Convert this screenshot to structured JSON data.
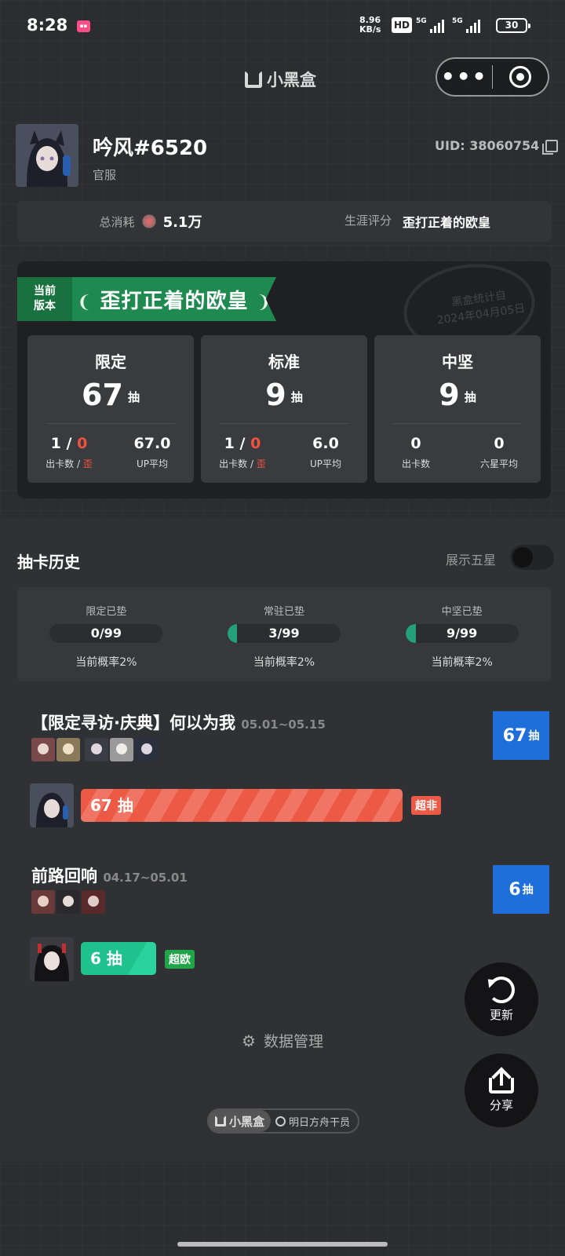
{
  "status": {
    "time": "8:28",
    "net_speed_value": "8.96",
    "net_speed_unit": "KB/s",
    "hd": "HD",
    "sig1": "5G",
    "sig2": "5G",
    "battery": "30"
  },
  "titlebar": {
    "brand": "小黑盒",
    "more": "•••"
  },
  "profile": {
    "name": "吟风#6520",
    "server": "官服",
    "uid": "UID: 38060754"
  },
  "summary": {
    "spend_label": "总消耗",
    "spend_value": "5.1万",
    "rating_label": "生涯评分",
    "rating_value": "歪打正着的欧皇"
  },
  "statcard": {
    "ribbon_tag_1": "当前",
    "ribbon_tag_2": "版本",
    "ribbon_title": "歪打正着的欧皇",
    "stamp_1": "黑盒统计自",
    "stamp_2": "2024年04月05日",
    "pools": [
      {
        "name": "限定",
        "count": "67",
        "unit": "抽",
        "stat1_a": "1",
        "stat1_b": "0",
        "stat1_label_a": "出卡数",
        "stat1_label_b": "歪",
        "stat2": "67.0",
        "stat2_label": "UP平均"
      },
      {
        "name": "标准",
        "count": "9",
        "unit": "抽",
        "stat1_a": "1",
        "stat1_b": "0",
        "stat1_label_a": "出卡数",
        "stat1_label_b": "歪",
        "stat2": "6.0",
        "stat2_label": "UP平均"
      },
      {
        "name": "中坚",
        "count": "9",
        "unit": "抽",
        "stat1": "0",
        "stat1_label": "出卡数",
        "stat2": "0",
        "stat2_label": "六星平均"
      }
    ]
  },
  "history": {
    "title": "抽卡历史",
    "show_five_star": "展示五星",
    "show_five_star_on": false,
    "pity": [
      {
        "label": "限定已垫",
        "value": "0/99",
        "progress": 0,
        "rate": "当前概率2%"
      },
      {
        "label": "常驻已垫",
        "value": "3/99",
        "progress": 0.03,
        "rate": "当前概率2%"
      },
      {
        "label": "中坚已垫",
        "value": "9/99",
        "progress": 0.09,
        "rate": "当前概率2%"
      }
    ],
    "banners": [
      {
        "title": "【限定寻访·庆典】何以为我",
        "date": "05.01~05.15",
        "count": "67",
        "unit": "抽",
        "bar_label": "67 抽",
        "tag": "超非",
        "tag_color": "#ec5a46"
      },
      {
        "title": "前路回响",
        "date": "04.17~05.01",
        "count": "6",
        "unit": "抽",
        "bar_label": "6 抽",
        "tag": "超欧",
        "tag_color": "#20a44a"
      }
    ]
  },
  "actions": {
    "refresh": "更新",
    "share": "分享",
    "data_manage": "数据管理"
  },
  "footer": {
    "brand": "小黑盒",
    "tag": "明日方舟干员"
  },
  "colors": {
    "accent_green": "#1f8a4f",
    "badge_blue": "#1e6fd9",
    "bad_red": "#ec5a46",
    "good_green": "#1fc28d"
  }
}
